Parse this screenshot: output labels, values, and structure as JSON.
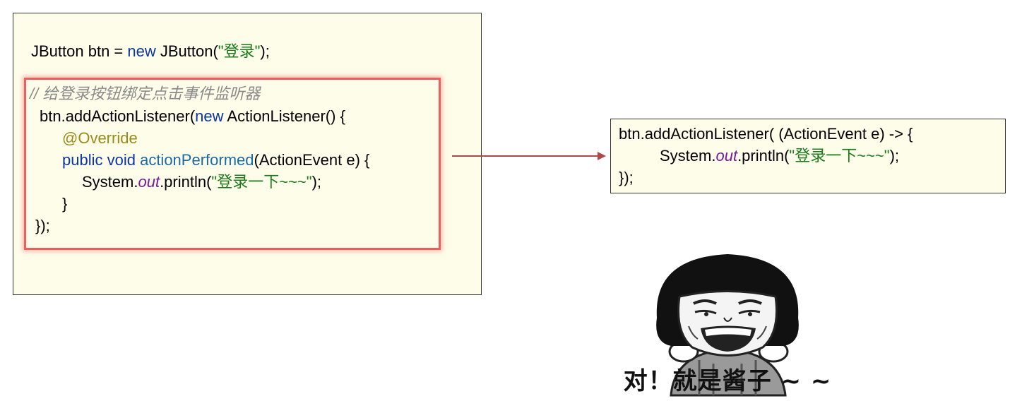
{
  "left_code": {
    "line1": {
      "a": "JButton btn = ",
      "b": "new",
      "c": " JButton(",
      "d": "\"登录\"",
      "e": ");"
    },
    "comment": "// 给登录按钮绑定点击事件监听器",
    "line3": {
      "a": "btn.addActionListener(",
      "b": "new",
      "c": " ActionListener() {"
    },
    "line4": "@Override",
    "line5": {
      "a": "public void ",
      "b": "actionPerformed",
      "c": "(ActionEvent e) {"
    },
    "line6": {
      "a": "System.",
      "b": "out",
      "c": ".println(",
      "d": "\"登录一下~~~\"",
      "e": ");"
    },
    "line7": "}",
    "line8": "});"
  },
  "right_code": {
    "line1": "btn.addActionListener( (ActionEvent e) -> {",
    "line2": {
      "a": "System.",
      "b": "out",
      "c": ".println(",
      "d": "\"登录一下~~~\"",
      "e": ");"
    },
    "line3": "});"
  },
  "meme": {
    "caption": "对！就是酱子 ~ ~"
  },
  "colors": {
    "code_bg": "#fefde9",
    "keyword": "#0b34a6",
    "string": "#1a7a1a",
    "comment": "#8a8a8a",
    "annotation": "#9a8a1a",
    "field": "#7a1a9a",
    "highlight_border": "#e86060",
    "arrow": "#b04848"
  }
}
